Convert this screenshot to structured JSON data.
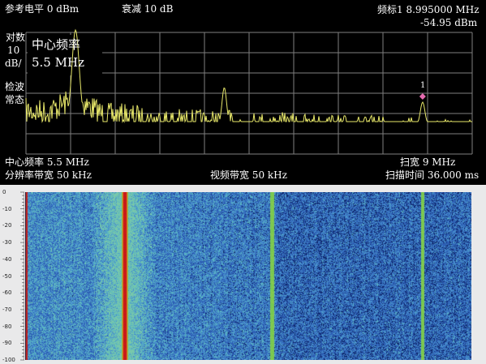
{
  "spectrum": {
    "ref_level": "参考电平 0 dBm",
    "attenuation": "衰减 10 dB",
    "marker_label": "频标1  8.995000 MHz",
    "marker_level": "-54.95 dBm",
    "scale_type": "对数",
    "scale_value": "10",
    "scale_unit": "dB/",
    "detector_line1": "检波",
    "detector_line2": "常态",
    "center_box_title": "中心频率",
    "center_box_value": "5.5 MHz",
    "center_freq": "中心频率 5.5 MHz",
    "rbw": "分辨率带宽 50 kHz",
    "vbw": "视频带宽 50 kHz",
    "span": "扫宽 9 MHz",
    "sweep_time": "扫描时间 36.000 ms",
    "marker_number": "1",
    "trace_color": "#e8e86a",
    "marker_color": "#e56bb0",
    "peaks_mhz": [
      2.0,
      5.0,
      9.0
    ],
    "noise_floor_db": -74
  },
  "waterfall": {
    "y_ticks": [
      "0",
      "-10",
      "-20",
      "-30",
      "-40",
      "-50",
      "-60",
      "-70",
      "-80",
      "-90",
      "-100"
    ],
    "base_color": "#2b63b5",
    "strong_color": "#c4202a",
    "medium_color": "#72c850"
  }
}
